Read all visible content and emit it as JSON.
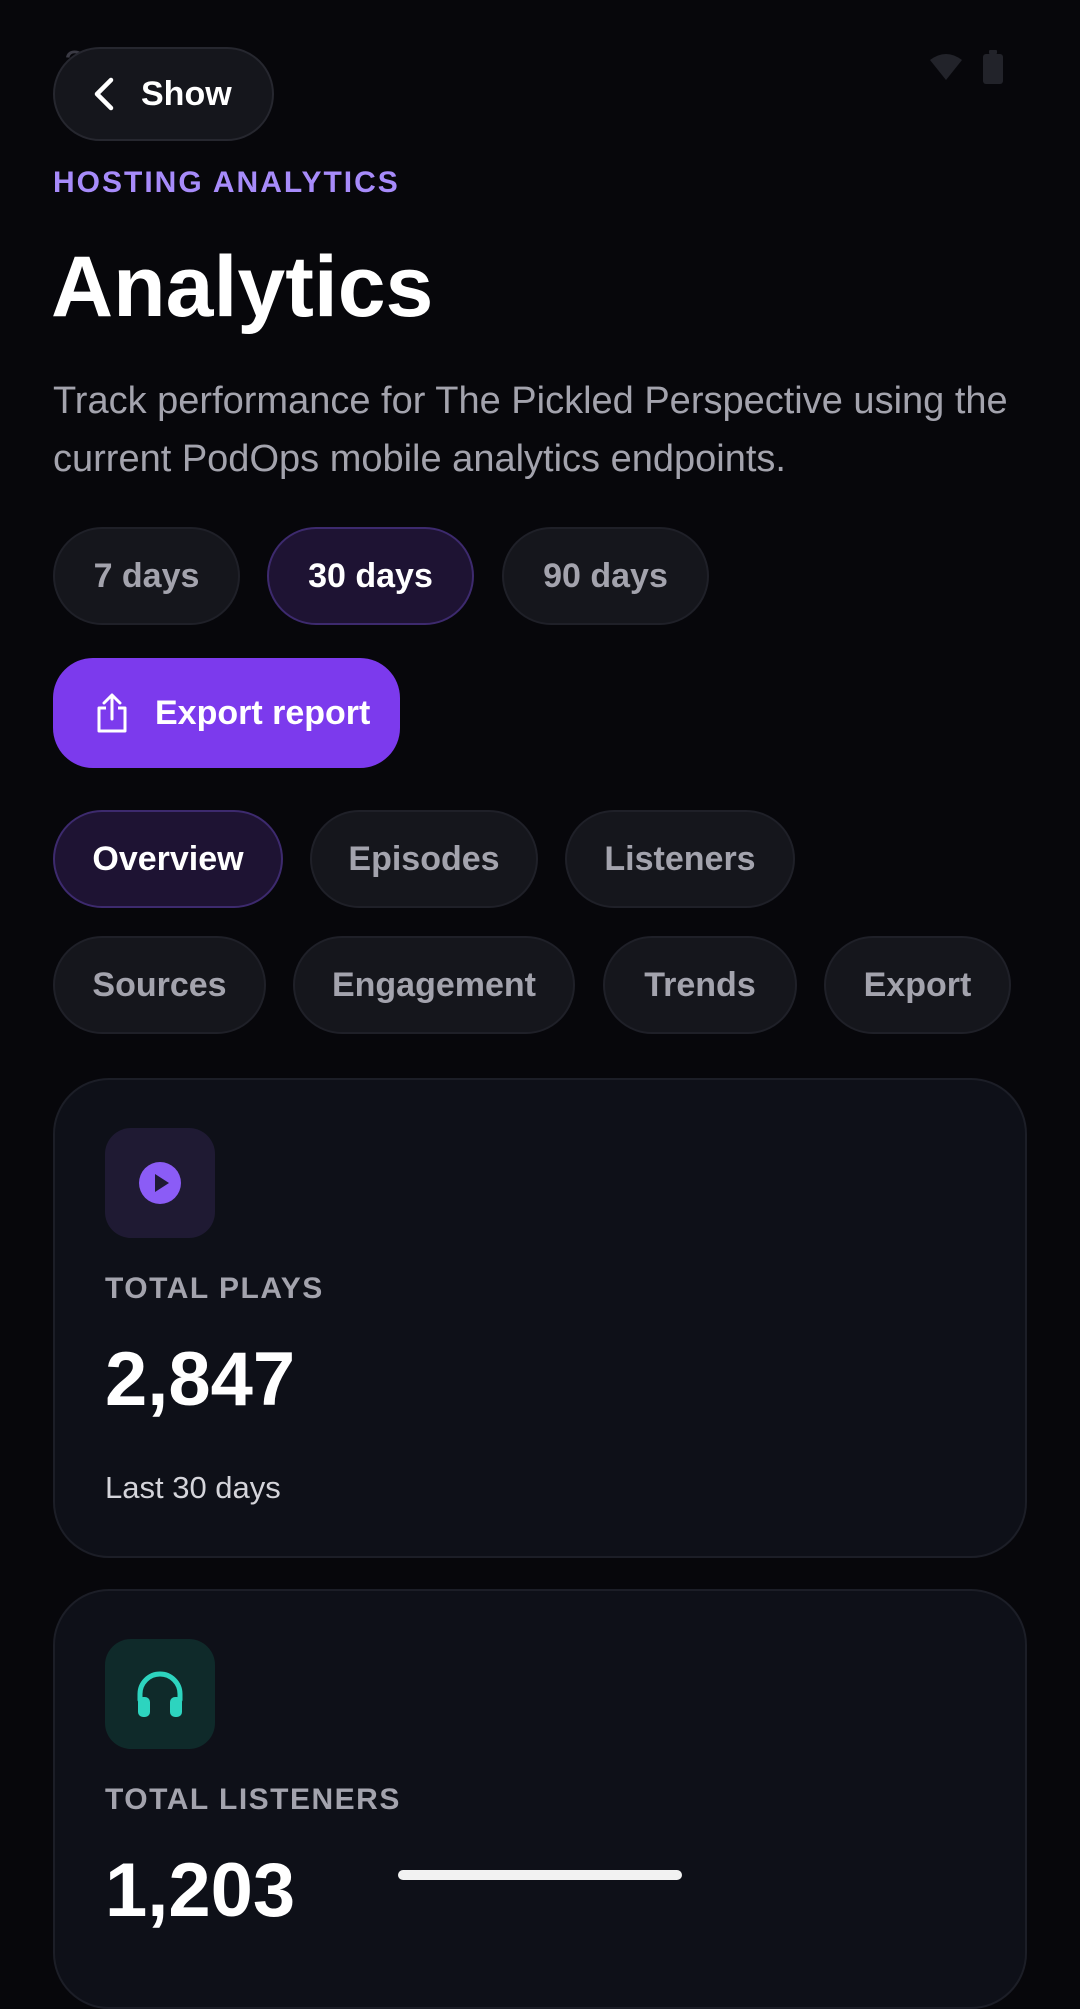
{
  "status_bar": {
    "time": "2:00"
  },
  "header": {
    "back_label": "Show",
    "eyebrow": "HOSTING ANALYTICS",
    "title": "Analytics",
    "subtitle": "Track performance for The Pickled Perspective using the current PodOps mobile analytics endpoints."
  },
  "range_chips": [
    {
      "label": "7 days",
      "active": false
    },
    {
      "label": "30 days",
      "active": true
    },
    {
      "label": "90 days",
      "active": false
    }
  ],
  "export_button": {
    "label": "Export report"
  },
  "tabs": [
    {
      "label": "Overview",
      "active": true
    },
    {
      "label": "Episodes",
      "active": false
    },
    {
      "label": "Listeners",
      "active": false
    },
    {
      "label": "Sources",
      "active": false
    },
    {
      "label": "Engagement",
      "active": false
    },
    {
      "label": "Trends",
      "active": false
    },
    {
      "label": "Export",
      "active": false
    }
  ],
  "cards": [
    {
      "icon": "play-circle-icon",
      "label": "TOTAL PLAYS",
      "value": "2,847",
      "note": "Last 30 days",
      "accent": "#8b5cf6"
    },
    {
      "icon": "headphones-icon",
      "label": "TOTAL LISTENERS",
      "value": "1,203",
      "accent": "#2dd4bf"
    }
  ],
  "colors": {
    "background": "#07070b",
    "accent_purple": "#7c3aed",
    "eyebrow": "#a78bfa",
    "muted_text": "#a3a3ad"
  }
}
